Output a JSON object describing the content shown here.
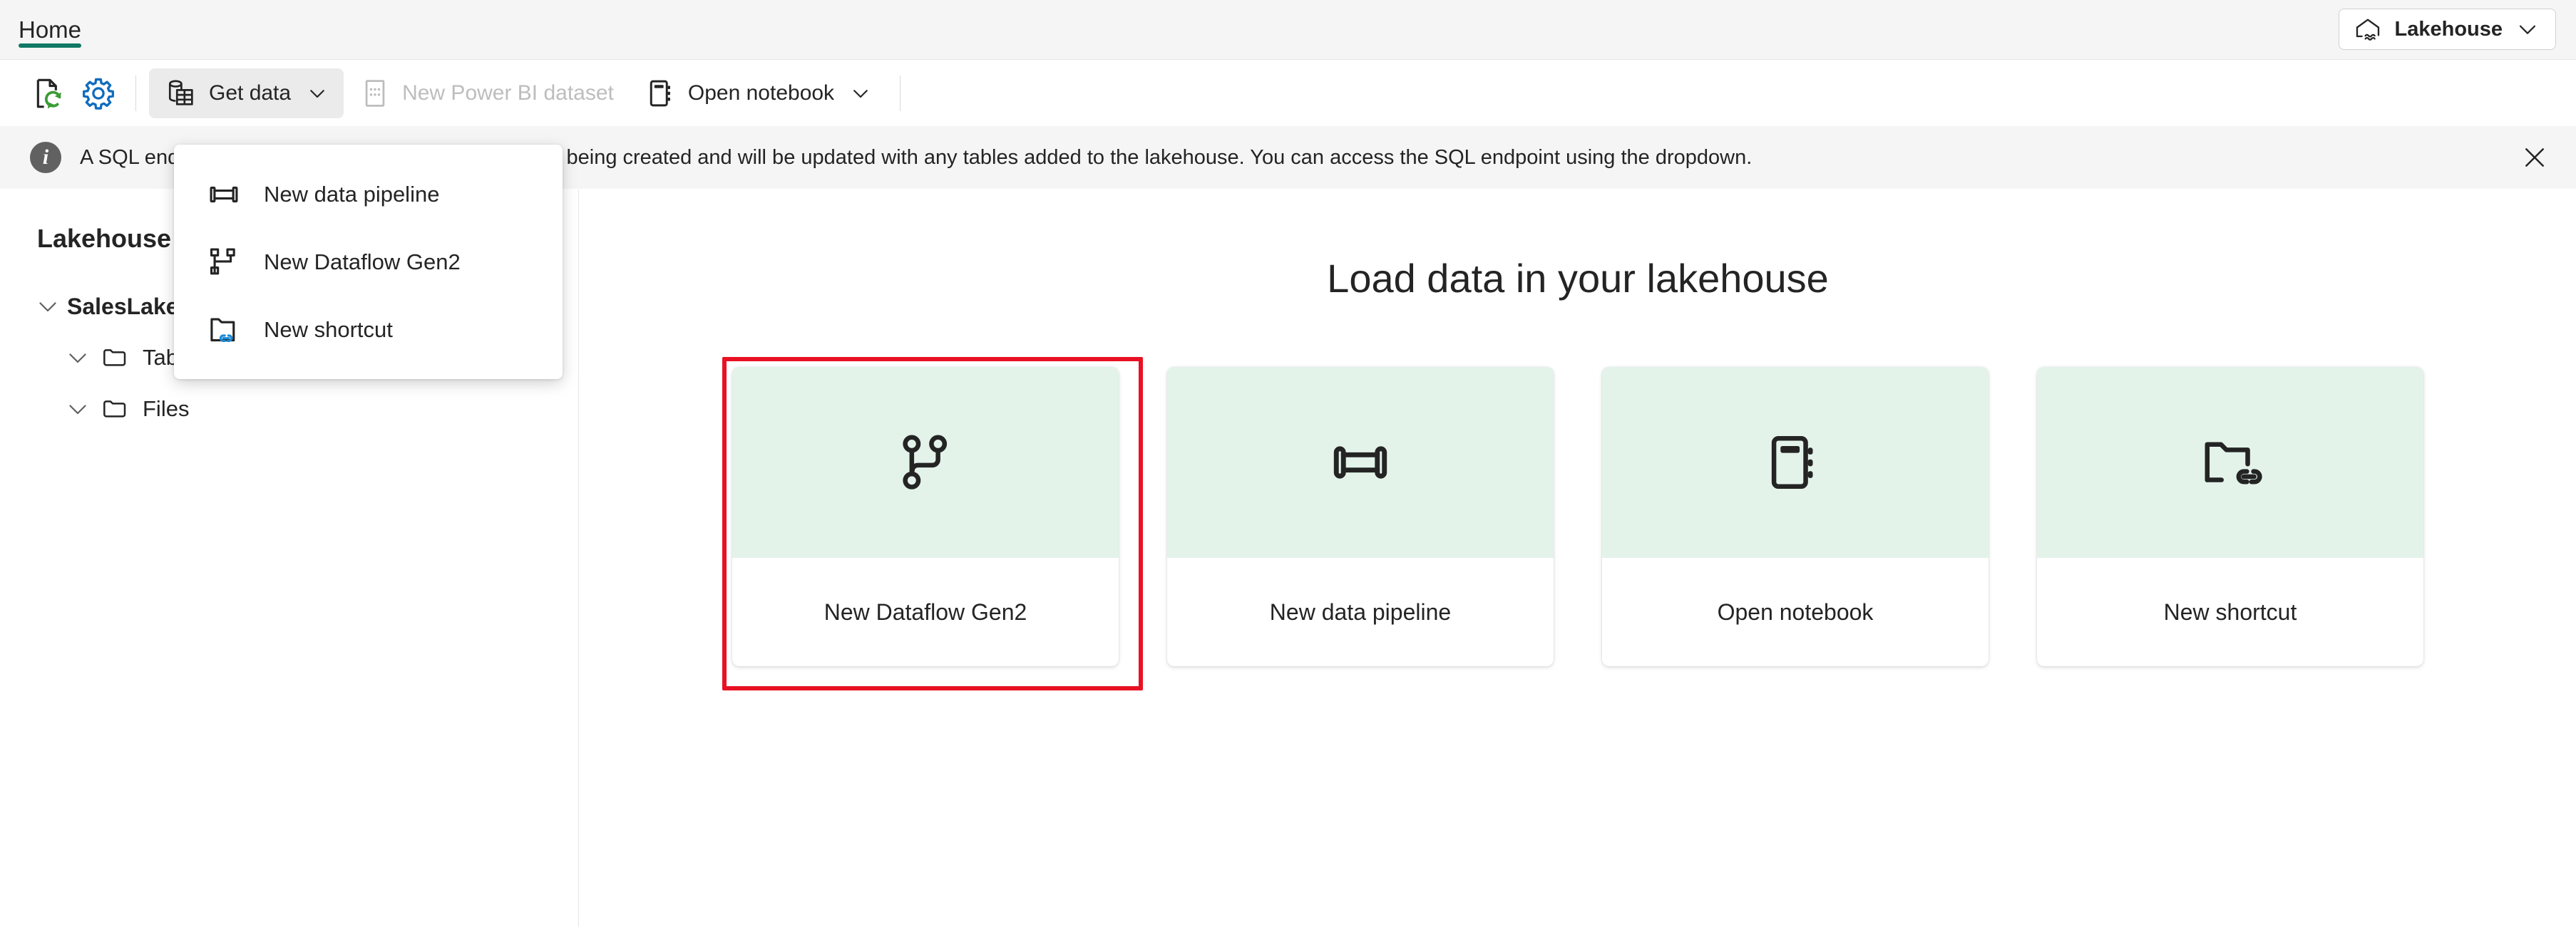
{
  "ribbon": {
    "tabs": [
      {
        "label": "Home",
        "active": true
      }
    ],
    "lakehouse_selector": {
      "label": "Lakehouse",
      "icon": "lakehouse-icon",
      "caret": "chevron-down-icon"
    }
  },
  "commandbar": {
    "refresh": {
      "name": "refresh-dataset-icon",
      "tooltip": "Refresh"
    },
    "settings": {
      "name": "settings-gear-icon",
      "tooltip": "Settings"
    },
    "get_data": {
      "label": "Get data",
      "active": true,
      "caret": "chevron-down-icon"
    },
    "new_powerbi_dataset": {
      "label": "New Power BI dataset",
      "disabled": true
    },
    "open_notebook": {
      "label": "Open notebook",
      "caret": "chevron-down-icon"
    }
  },
  "get_data_menu": {
    "open": true,
    "items": [
      {
        "label": "New data pipeline",
        "icon": "pipeline-icon"
      },
      {
        "label": "New Dataflow Gen2",
        "icon": "dataflow-icon"
      },
      {
        "label": "New shortcut",
        "icon": "shortcut-folder-icon"
      }
    ]
  },
  "info_banner": {
    "icon": "info-icon",
    "text": "A SQL endpoint and a default dataset for reporting is being created and will be updated with any tables added to the lakehouse. You can access the SQL endpoint using the dropdown.",
    "close": "close-icon"
  },
  "sidebar": {
    "title": "Lakehouse",
    "tree": [
      {
        "label": "SalesLakenouse",
        "level": 0,
        "expanded": true,
        "root": true,
        "has_folder_icon": false
      },
      {
        "label": "Tables",
        "level": 1,
        "expanded": true,
        "root": false,
        "has_folder_icon": true
      },
      {
        "label": "Files",
        "level": 1,
        "expanded": true,
        "root": false,
        "has_folder_icon": true
      }
    ]
  },
  "main": {
    "heading": "Load data in your lakehouse",
    "cards": [
      {
        "label": "New Dataflow Gen2",
        "icon": "dataflow-icon",
        "highlighted": true
      },
      {
        "label": "New data pipeline",
        "icon": "pipeline-icon",
        "highlighted": false
      },
      {
        "label": "Open notebook",
        "icon": "notebook-icon",
        "highlighted": false
      },
      {
        "label": "New shortcut",
        "icon": "shortcut-folder-icon",
        "highlighted": false
      }
    ]
  },
  "colors": {
    "accent_green": "#117865",
    "card_tile_bg": "#e3f3ea",
    "highlight_red": "#e81123",
    "link_blue": "#0f6cbd",
    "refresh_green": "#3a9b35",
    "banner_bg": "#f5f5f5"
  }
}
